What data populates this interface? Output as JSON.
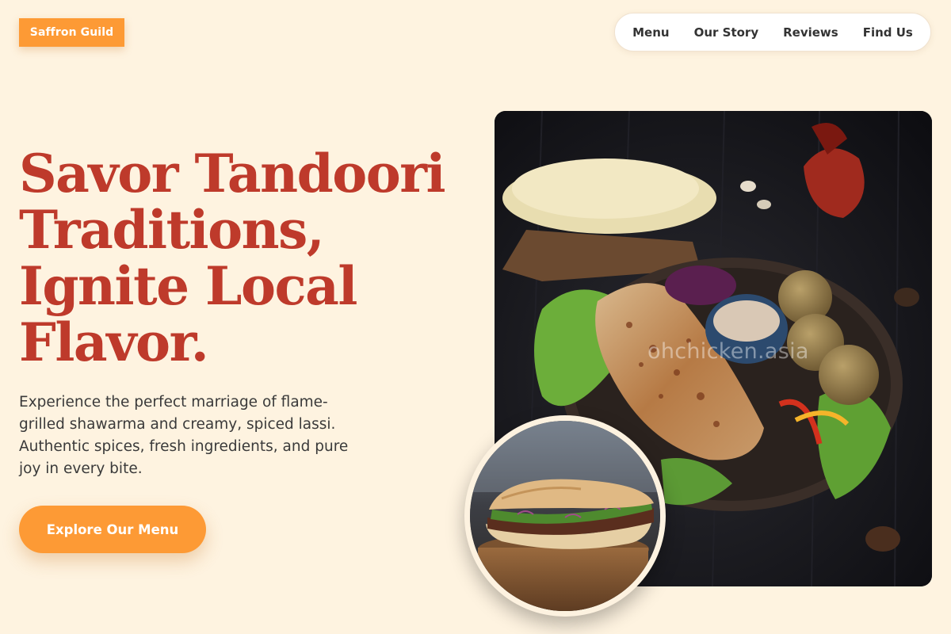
{
  "brand": {
    "name": "Saffron Guild",
    "accent_color": "#fd9a35",
    "title_color": "#be3a2b",
    "background_color": "#fef3e0"
  },
  "nav": {
    "items": [
      {
        "label": "Menu"
      },
      {
        "label": "Our Story"
      },
      {
        "label": "Reviews"
      },
      {
        "label": "Find Us"
      }
    ]
  },
  "hero": {
    "title_lines": [
      "Savor Tandoori",
      "Traditions,",
      "Ignite Local",
      "Flavor."
    ],
    "description": "Experience the perfect marriage of flame-grilled shawarma and creamy, spiced lassi. Authentic spices, fresh ingredients, and pure joy in every bite.",
    "cta_label": "Explore Our Menu"
  },
  "images": {
    "main_watermark": "ohchicken.asia",
    "main_subject": "grilled flatbread wrap platter with falafel, salad and dipping sauce",
    "inset_subject": "shawarma sandwich on a wooden board"
  }
}
